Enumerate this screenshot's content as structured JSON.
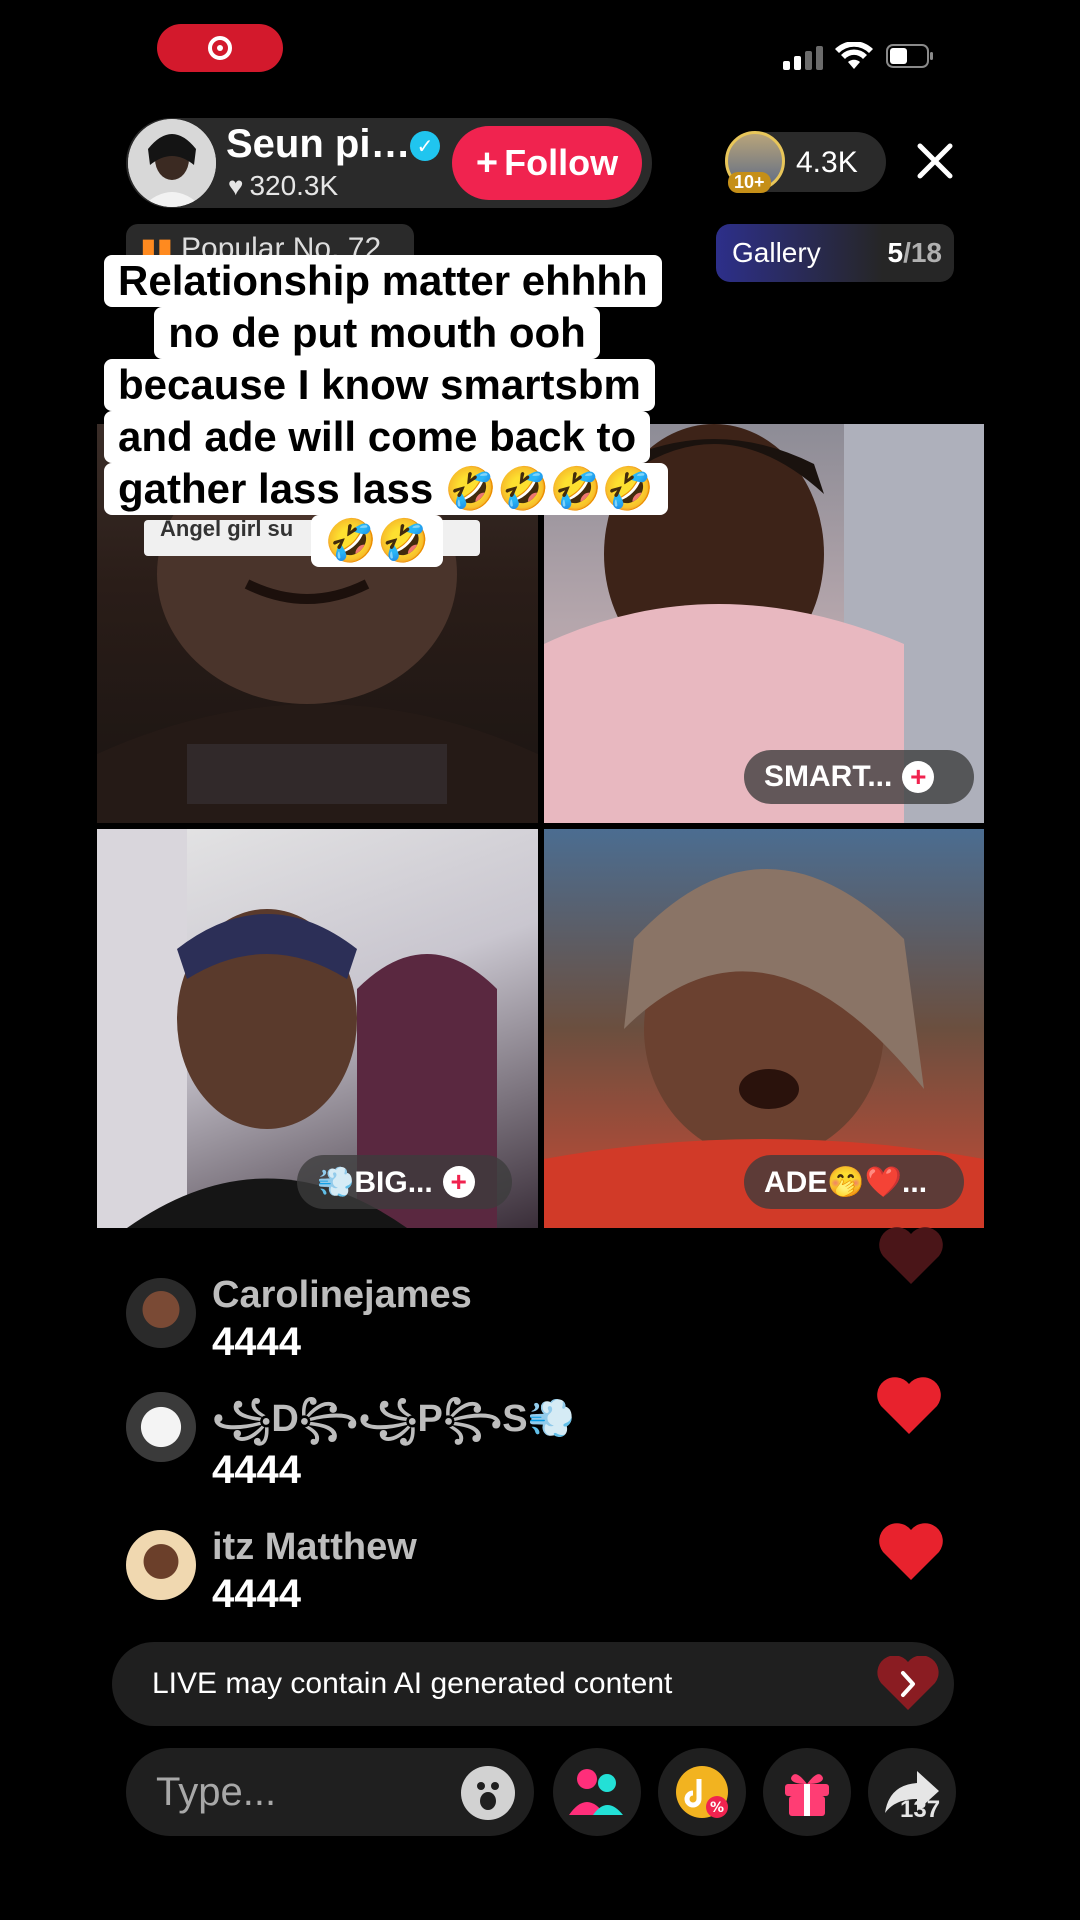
{
  "status_bar": {
    "recording": true,
    "signal_bars": 4,
    "battery_level": 0.4
  },
  "host": {
    "name": "Seun pi…",
    "likes": "320.3K",
    "follow_label": "Follow",
    "verified": true
  },
  "viewers": {
    "badge": "10+",
    "count": "4.3K"
  },
  "popular_label": "Popular No. 72",
  "gallery": {
    "label": "Gallery",
    "current": "5",
    "total": "/18"
  },
  "caption": {
    "lines": [
      "Relationship matter ehhhh",
      "no de put mouth ooh",
      "because I know smartsbm",
      "and ade will come back to",
      "gather lass lass 🤣🤣🤣🤣",
      "🤣🤣"
    ]
  },
  "guests": [
    {
      "name": "Angel girl su…",
      "label_strip": "Angel girl su"
    },
    {
      "name": "SMART..."
    },
    {
      "name": "💨BIG..."
    },
    {
      "name": "ADE🤭❤️..."
    }
  ],
  "comments": [
    {
      "user": "Carolinejames",
      "text": "4444"
    },
    {
      "user": "꧁D꧂꧁P꧂S💨",
      "text": "4444"
    },
    {
      "user": "itz Matthew",
      "text": "4444"
    }
  ],
  "ai_notice": "LIVE may contain AI generated content",
  "bottom_bar": {
    "input_placeholder": "Type...",
    "share_count": "137"
  },
  "colors": {
    "accent": "#f0234f",
    "verified": "#20c5ef",
    "heart": "#e8222d"
  },
  "icons": [
    "record-icon",
    "signal-icon",
    "wifi-icon",
    "battery-icon",
    "verified-icon",
    "heart-icon",
    "close-icon",
    "fire-icon",
    "chevron-right-icon",
    "smiley-icon",
    "guests-icon",
    "tiktok-coin-icon",
    "gift-icon",
    "share-icon"
  ]
}
